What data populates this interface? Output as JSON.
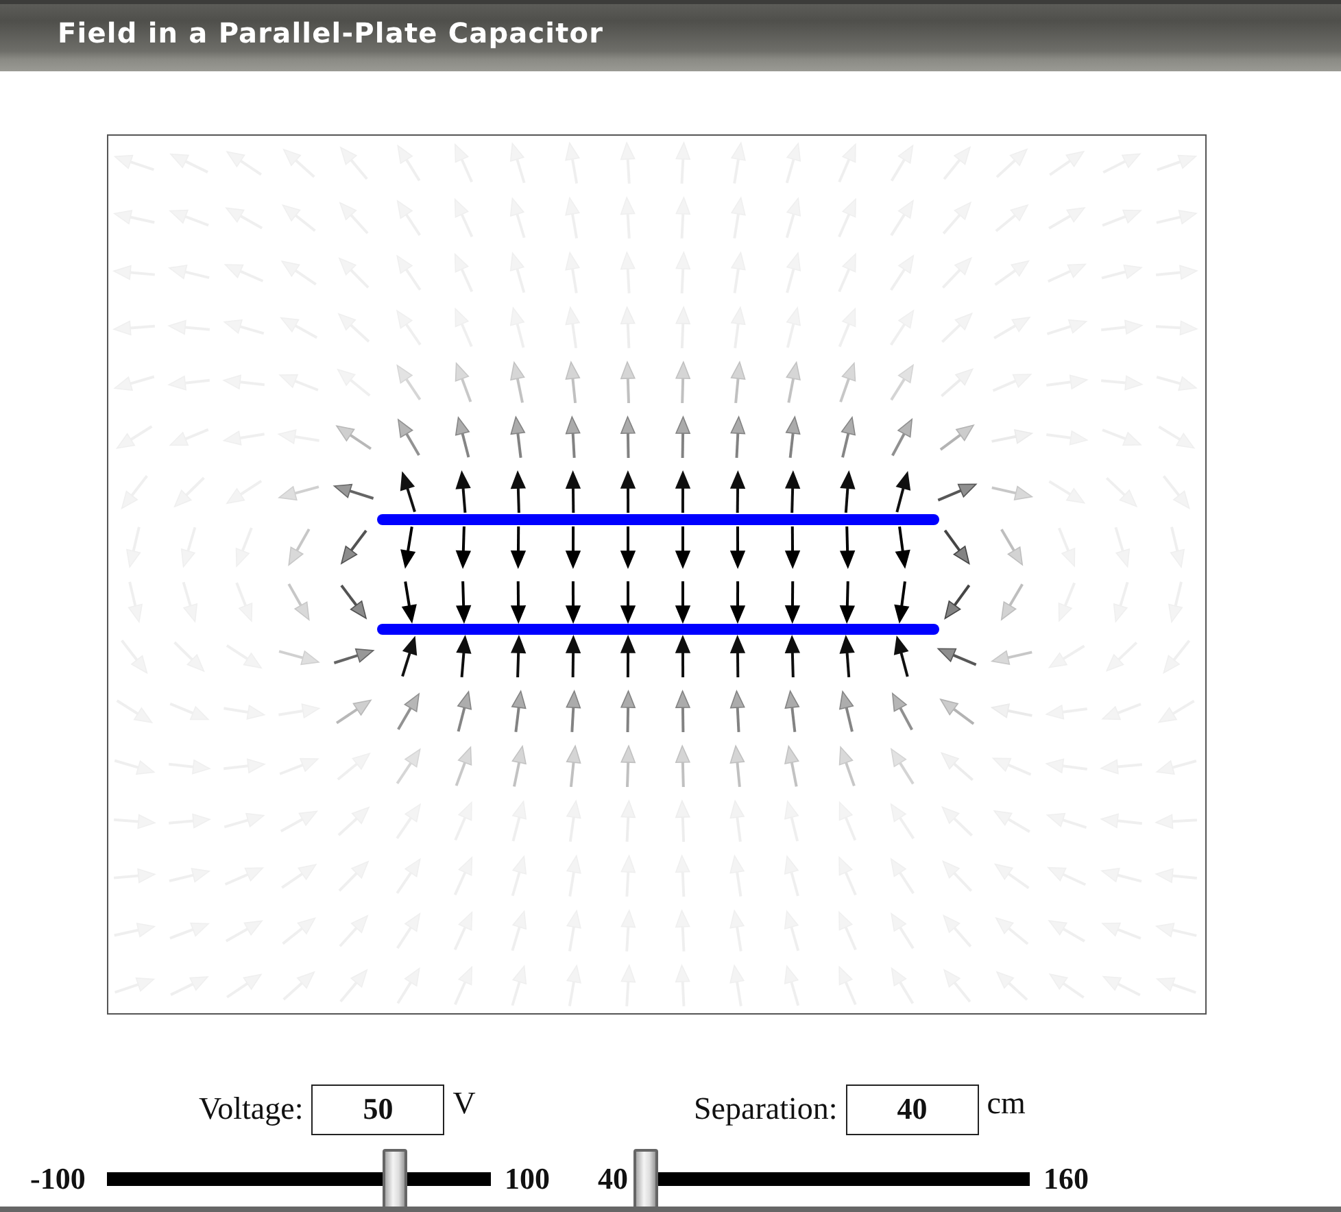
{
  "title": "Field in a Parallel-Plate Capacitor",
  "voltage": {
    "label": "Voltage:",
    "value": "50",
    "unit": "V",
    "min": "-100",
    "max": "100",
    "level": 0.75
  },
  "separation": {
    "label": "Separation:",
    "value": "40",
    "unit": "cm",
    "min": "40",
    "max": "160",
    "level": 0
  }
}
